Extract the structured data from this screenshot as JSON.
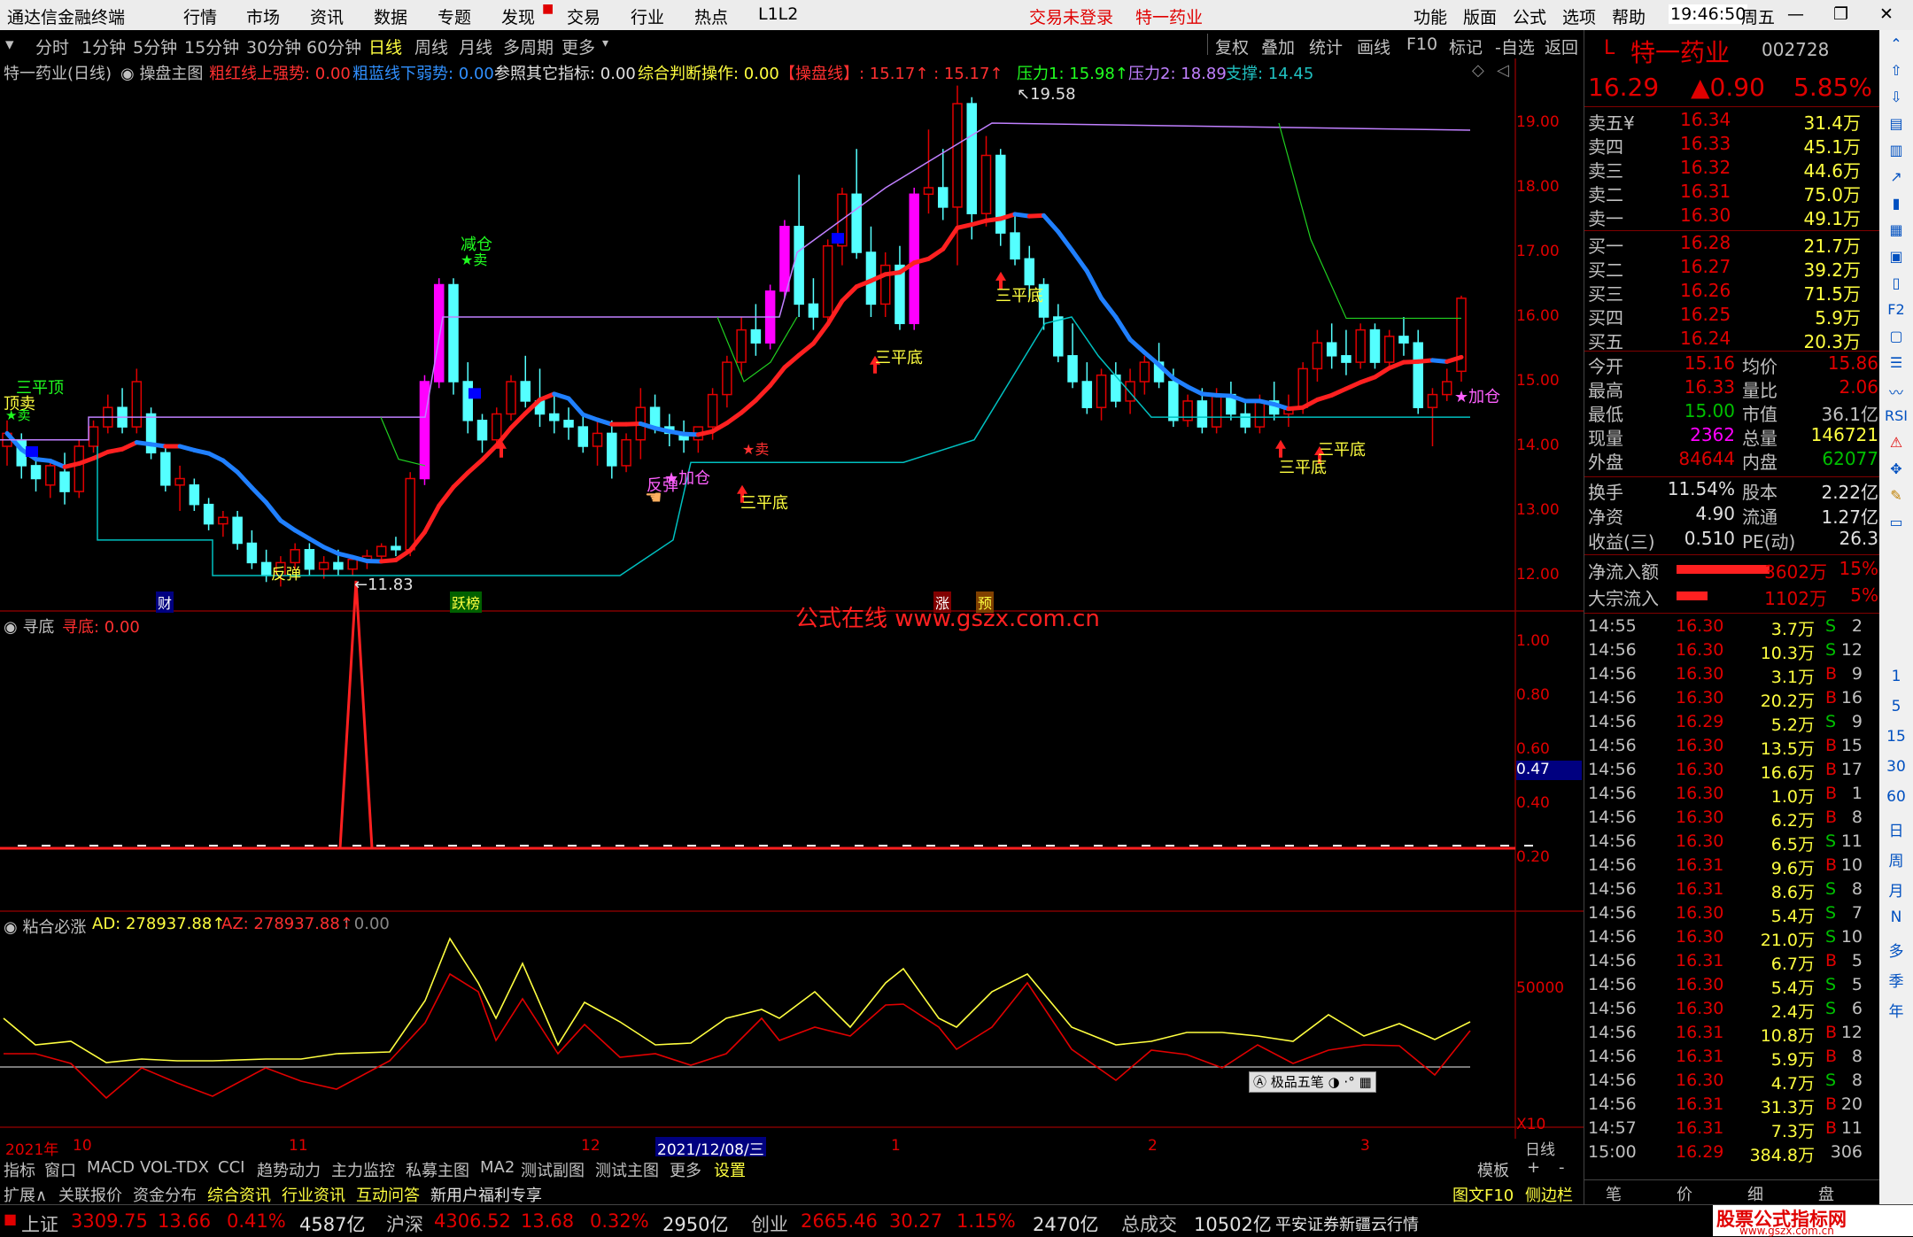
{
  "app": {
    "title": "通达信金融终端",
    "login_status": "交易未登录",
    "stock_short": "特一药业",
    "time": "19:46:50",
    "weekday": "周五"
  },
  "menu": [
    "行情",
    "市场",
    "资讯",
    "数据",
    "专题",
    "发现",
    "交易",
    "行业",
    "热点",
    "L1L2"
  ],
  "menu_right": [
    "功能",
    "版面",
    "公式",
    "选项",
    "帮助"
  ],
  "periods": [
    "分时",
    "1分钟",
    "5分钟",
    "15分钟",
    "30分钟",
    "60分钟",
    "日线",
    "周线",
    "月线",
    "多周期",
    "更多"
  ],
  "period_active": "日线",
  "chart_tools": [
    "复权",
    "叠加",
    "统计",
    "画线",
    "F10",
    "标记",
    "-自选",
    "返回"
  ],
  "main_header": {
    "name": "特一药业(日线)",
    "formula": "操盘主图",
    "red_label": "粗红线上强势: 0.00",
    "blue_label": "粗蓝线下弱势: 0.00",
    "ref_label": "参照其它指标: 0.00",
    "judge_label": "综合判断操作: 0.00",
    "caopan_label": "【操盘线】: 15.17↑ : 15.17↑",
    "resist1": "压力1: 15.98↑",
    "resist2": "压力2: 18.89",
    "support": "支撑: 14.45"
  },
  "sub1_header": {
    "name": "寻底",
    "value": "寻底: 0.00"
  },
  "sub2_header": {
    "name": "粘合必涨",
    "ad": "AD: 278937.88↑",
    "az": "AZ: 278937.88↑",
    "extra": ": 0.00"
  },
  "watermark": "公式在线 www.gszx.com.cn",
  "main_axis": [
    "19.00",
    "18.00",
    "17.00",
    "16.00",
    "15.00",
    "14.00",
    "13.00",
    "12.00"
  ],
  "sub1_axis": [
    "1.00",
    "0.80",
    "0.60",
    "0.40",
    "0.20"
  ],
  "sub1_current": "0.47",
  "sub2_axis": [
    "50000"
  ],
  "sub2_scale": "X10",
  "x_axis": [
    {
      "label": "2021年"
    },
    {
      "label": "10"
    },
    {
      "label": "11"
    },
    {
      "label": "12"
    },
    {
      "label": "2021/12/08/三"
    },
    {
      "label": "1"
    },
    {
      "label": "2"
    },
    {
      "label": "3"
    },
    {
      "label": "日线"
    }
  ],
  "annotations": {
    "high": "19.58",
    "low": "←11.83",
    "sanping_top": "三平顶",
    "top_sell": "顶卖",
    "jiancang": "减仓",
    "sell_star": "★卖",
    "sanpingdi": "三平底",
    "fantan": "反弹",
    "jiacang": "★加仓",
    "sell2": "★卖",
    "cai": "财",
    "zhang": "涨",
    "yu": "预",
    "yuebang": "跃榜"
  },
  "quote": {
    "name": "特一药业",
    "code": "002728",
    "prefix": "L",
    "price": "16.29",
    "change": "▲0.90",
    "pct": "5.85%",
    "asks": [
      {
        "label": "卖五¥",
        "price": "16.34",
        "vol": "31.4万"
      },
      {
        "label": "卖四",
        "price": "16.33",
        "vol": "45.1万"
      },
      {
        "label": "卖三",
        "price": "16.32",
        "vol": "44.6万"
      },
      {
        "label": "卖二",
        "price": "16.31",
        "vol": "75.0万"
      },
      {
        "label": "卖一",
        "price": "16.30",
        "vol": "49.1万"
      }
    ],
    "bids": [
      {
        "label": "买一",
        "price": "16.28",
        "vol": "21.7万"
      },
      {
        "label": "买二",
        "price": "16.27",
        "vol": "39.2万"
      },
      {
        "label": "买三",
        "price": "16.26",
        "vol": "71.5万"
      },
      {
        "label": "买四",
        "price": "16.25",
        "vol": "5.9万"
      },
      {
        "label": "买五",
        "price": "16.24",
        "vol": "20.3万"
      }
    ],
    "stats": [
      {
        "l1": "今开",
        "v1": "15.16",
        "c1": "#e00000",
        "l2": "均价",
        "v2": "15.86",
        "c2": "#e00000"
      },
      {
        "l1": "最高",
        "v1": "16.33",
        "c1": "#e00000",
        "l2": "量比",
        "v2": "2.06",
        "c2": "#e00000"
      },
      {
        "l1": "最低",
        "v1": "15.00",
        "c1": "#00c000",
        "l2": "市值",
        "v2": "36.1亿",
        "c2": "#c0c0c0"
      },
      {
        "l1": "现量",
        "v1": "2362",
        "c1": "#ff00ff",
        "l2": "总量",
        "v2": "146721",
        "c2": "#ffff40"
      },
      {
        "l1": "外盘",
        "v1": "84644",
        "c1": "#e00000",
        "l2": "内盘",
        "v2": "62077",
        "c2": "#00c000"
      }
    ],
    "fund": [
      {
        "l1": "换手",
        "v1": "11.54%",
        "l2": "股本",
        "v2": "2.22亿"
      },
      {
        "l1": "净资",
        "v1": "4.90",
        "l2": "流通",
        "v2": "1.27亿"
      },
      {
        "l1": "收益(三)",
        "v1": "0.510",
        "l2": "PE(动)",
        "v2": "26.3"
      }
    ],
    "flows": [
      {
        "label": "净流入额",
        "value": "3602万",
        "pct": "15%",
        "bar": 0.15
      },
      {
        "label": "大宗流入",
        "value": "1102万",
        "pct": "5%",
        "bar": 0.05
      }
    ],
    "ticks": [
      [
        "14:55",
        "16.30",
        "3.7万",
        "S",
        "2"
      ],
      [
        "14:56",
        "16.30",
        "10.3万",
        "S",
        "12"
      ],
      [
        "14:56",
        "16.30",
        "3.1万",
        "B",
        "9"
      ],
      [
        "14:56",
        "16.30",
        "20.2万",
        "B",
        "16"
      ],
      [
        "14:56",
        "16.29",
        "5.2万",
        "S",
        "9"
      ],
      [
        "14:56",
        "16.30",
        "13.5万",
        "B",
        "15"
      ],
      [
        "14:56",
        "16.30",
        "16.6万",
        "B",
        "17"
      ],
      [
        "14:56",
        "16.30",
        "1.0万",
        "B",
        "1"
      ],
      [
        "14:56",
        "16.30",
        "6.2万",
        "B",
        "8"
      ],
      [
        "14:56",
        "16.30",
        "6.5万",
        "S",
        "11"
      ],
      [
        "14:56",
        "16.31",
        "9.6万",
        "B",
        "10"
      ],
      [
        "14:56",
        "16.31",
        "8.6万",
        "S",
        "8"
      ],
      [
        "14:56",
        "16.30",
        "5.4万",
        "S",
        "7"
      ],
      [
        "14:56",
        "16.30",
        "21.0万",
        "S",
        "10"
      ],
      [
        "14:56",
        "16.31",
        "6.7万",
        "B",
        "5"
      ],
      [
        "14:56",
        "16.30",
        "5.4万",
        "S",
        "5"
      ],
      [
        "14:56",
        "16.30",
        "2.4万",
        "S",
        "6"
      ],
      [
        "14:56",
        "16.31",
        "10.8万",
        "B",
        "12"
      ],
      [
        "14:56",
        "16.31",
        "5.9万",
        "B",
        "8"
      ],
      [
        "14:56",
        "16.30",
        "4.7万",
        "S",
        "8"
      ],
      [
        "14:56",
        "16.31",
        "31.3万",
        "B",
        "20"
      ],
      [
        "14:57",
        "16.31",
        "7.3万",
        "B",
        "11"
      ],
      [
        "15:00",
        "16.29",
        "384.8万",
        "",
        "306"
      ]
    ],
    "bottom_tabs": [
      "笔",
      "价",
      "细",
      "盘"
    ]
  },
  "right_tools": [
    "1",
    "5",
    "15",
    "30",
    "60",
    "日",
    "周",
    "月",
    "N",
    "多",
    "季",
    "年"
  ],
  "bottom_tabs": [
    "指标",
    "窗口",
    "MACD",
    "VOL-TDX",
    "CCI",
    "趋势动力",
    "主力监控",
    "私募主图",
    "MA2",
    "测试副图",
    "测试主图",
    "更多",
    "设置",
    "模板",
    "+",
    "-"
  ],
  "ext_tabs": [
    "扩展∧",
    "关联报价",
    "资金分布",
    "综合资讯",
    "行业资讯",
    "互动问答",
    "新用户福利专享"
  ],
  "ext_right": [
    "图文F10",
    "侧边栏《"
  ],
  "ime": "极品五笔",
  "status": {
    "sh": {
      "name": "上证",
      "val": "3309.75",
      "chg": "13.66",
      "pct": "0.41%",
      "amt": "4587亿"
    },
    "hs": {
      "name": "沪深",
      "val": "4306.52",
      "chg": "13.68",
      "pct": "0.32%",
      "amt": "2950亿"
    },
    "cy": {
      "name": "创业",
      "val": "2665.46",
      "chg": "30.27",
      "pct": "1.15%",
      "amt": "2470亿"
    },
    "total_label": "总成交",
    "total": "10502亿",
    "broker": "平安证券新疆云行情"
  },
  "logo": {
    "line1": "股票公式指标网",
    "line2": "www.gszx.com.cn"
  },
  "colors": {
    "up": "#e00000",
    "down": "#54ffff",
    "ma_red": "#ff2020",
    "ma_blue": "#2080ff",
    "support": "#00c0c0",
    "resist": "#c080ff",
    "highlight": "#ff00ff"
  }
}
